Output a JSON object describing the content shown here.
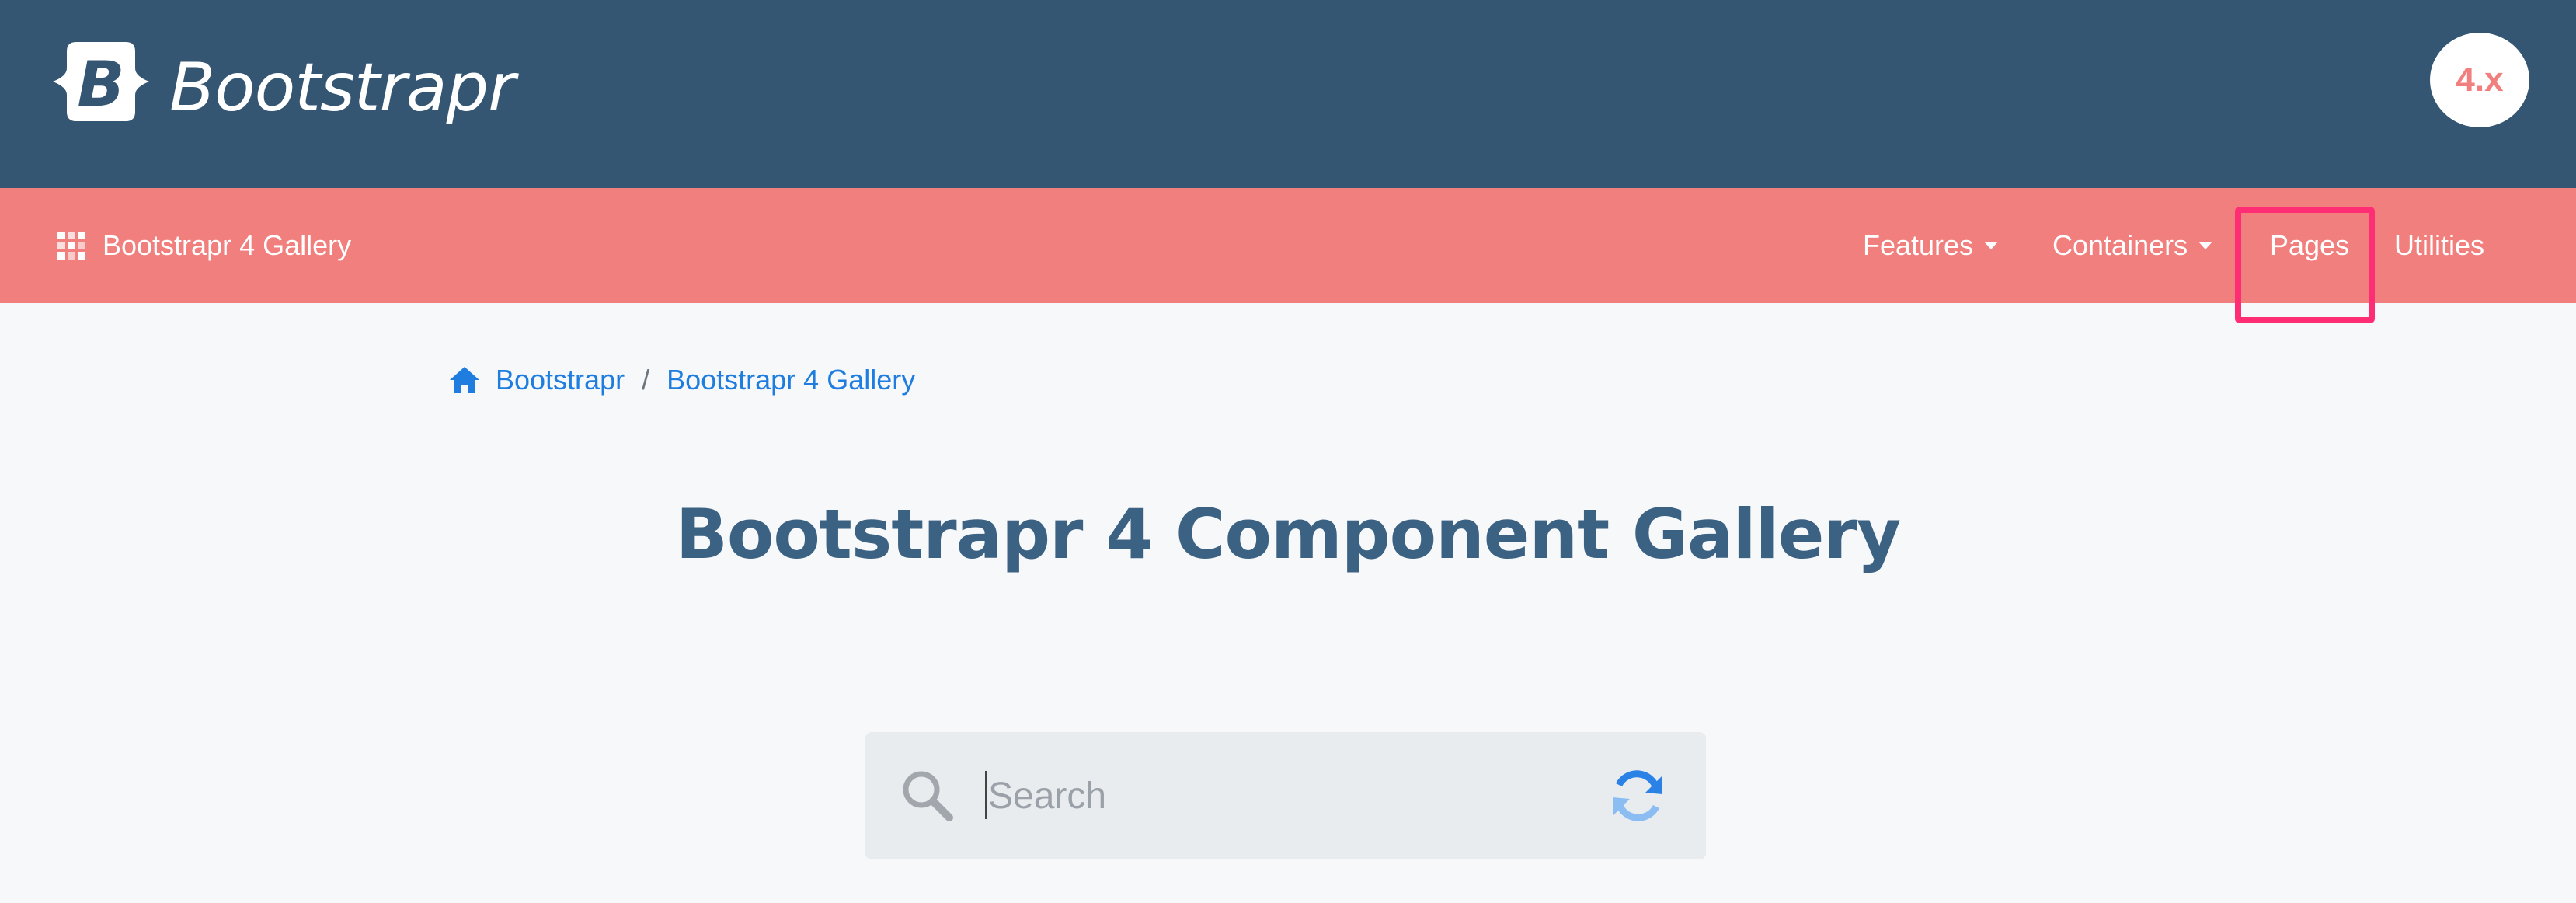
{
  "header": {
    "brand_letter": "B",
    "brand_name": "Bootstrapr",
    "version": "4.x",
    "colors": {
      "header_bg": "#345673",
      "badge_text": "#f07f7e"
    }
  },
  "navbar": {
    "gallery_icon": "grid-icon",
    "gallery_label": "Bootstrapr 4 Gallery",
    "items": [
      {
        "label": "Features",
        "dropdown": true
      },
      {
        "label": "Containers",
        "dropdown": true
      },
      {
        "label": "Pages",
        "dropdown": false,
        "highlighted": true
      },
      {
        "label": "Utilities",
        "dropdown": false
      }
    ],
    "colors": {
      "bg": "#f07f7e",
      "highlight": "#ff2d73"
    }
  },
  "breadcrumb": {
    "home_icon": "home-icon",
    "items": [
      "Bootstrapr",
      "Bootstrapr 4 Gallery"
    ],
    "separator": "/"
  },
  "main": {
    "title": "Bootstrapr 4 Component Gallery",
    "colors": {
      "title": "#3c6283",
      "link": "#1f7de0"
    }
  },
  "search": {
    "placeholder": "Search",
    "value": "",
    "left_icon": "search-icon",
    "right_icon": "refresh-icon"
  }
}
